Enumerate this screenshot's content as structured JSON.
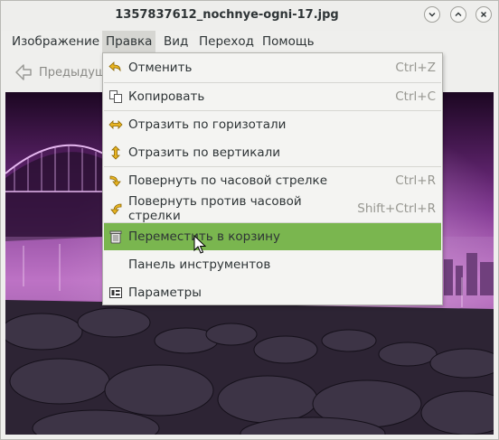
{
  "window": {
    "title": "1357837612_nochnye-ogni-17.jpg"
  },
  "menubar": {
    "items": [
      {
        "label": "Изображение"
      },
      {
        "label": "Правка"
      },
      {
        "label": "Вид"
      },
      {
        "label": "Переход"
      },
      {
        "label": "Помощь"
      }
    ]
  },
  "toolbar": {
    "prev_label": "Предыдущ"
  },
  "edit_menu": {
    "items": [
      {
        "label": "Отменить",
        "shortcut": "Ctrl+Z",
        "icon": "undo-icon"
      },
      {
        "label": "Копировать",
        "shortcut": "Ctrl+C",
        "icon": "copy-icon"
      },
      {
        "label": "Отразить по горизотали",
        "shortcut": "",
        "icon": "flip-horizontal-icon"
      },
      {
        "label": "Отразить по вертикали",
        "shortcut": "",
        "icon": "flip-vertical-icon"
      },
      {
        "label": "Повернуть по часовой стрелке",
        "shortcut": "Ctrl+R",
        "icon": "rotate-clockwise-icon"
      },
      {
        "label": "Повернуть против часовой стрелки",
        "shortcut": "Shift+Ctrl+R",
        "icon": "rotate-counterclockwise-icon"
      },
      {
        "label": "Переместить в корзину",
        "shortcut": "",
        "icon": "trash-icon"
      },
      {
        "label": "Панель инструментов",
        "shortcut": "",
        "icon": ""
      },
      {
        "label": "Параметры",
        "shortcut": "",
        "icon": "preferences-icon"
      }
    ],
    "highlighted_index": 6
  },
  "colors": {
    "highlight": "#7ab64f",
    "menu_bg": "#f4f4f2",
    "active_menu": "#d6d6d2"
  }
}
